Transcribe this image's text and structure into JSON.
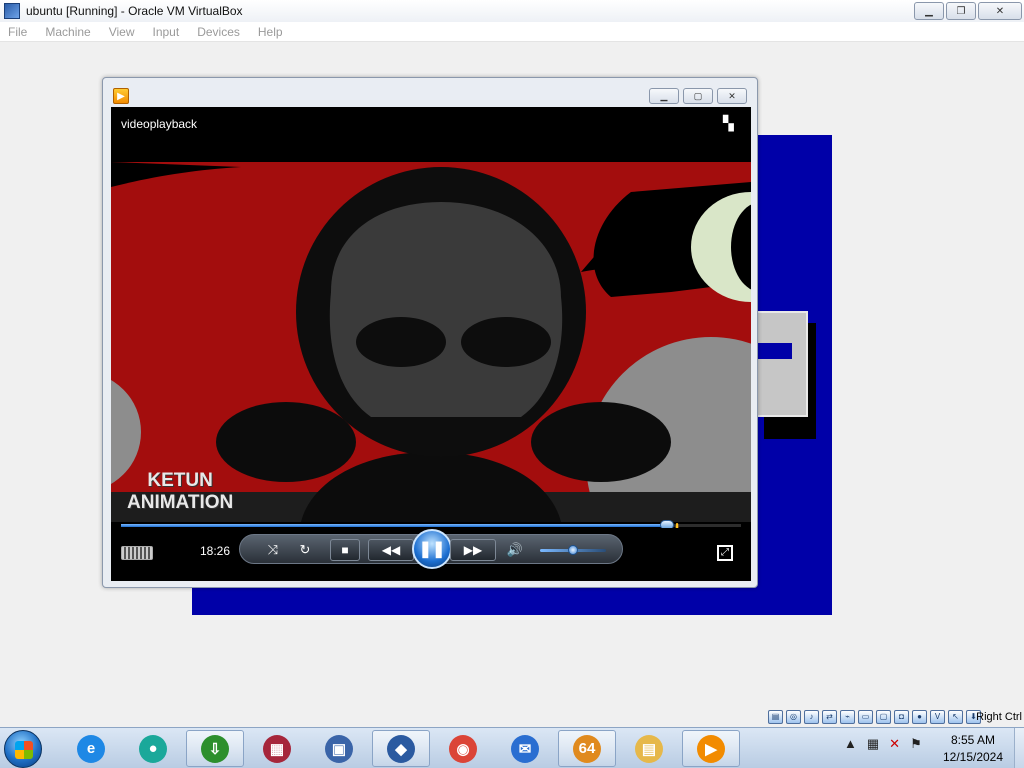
{
  "host_window": {
    "title": "ubuntu [Running] - Oracle VM VirtualBox",
    "menu": [
      "File",
      "Machine",
      "View",
      "Input",
      "Devices",
      "Help"
    ]
  },
  "media_player": {
    "video_title": "videoplayback",
    "watermark_line1": "KETUN",
    "watermark_line2": "ANIMATION",
    "time_elapsed": "18:26",
    "seek_progress": 0.88,
    "volume_level": 0.5,
    "buttons": {
      "shuffle": "⤨",
      "repeat": "↻",
      "stop": "■",
      "previous": "◀◀",
      "play_pause": "❚❚",
      "next": "▶▶",
      "mute": "🔊",
      "fullscreen": "⤢"
    }
  },
  "status_bar": {
    "host_key": "Right Ctrl"
  },
  "taskbar": {
    "apps": [
      {
        "name": "Internet Explorer",
        "glyph": "e",
        "color": "#1e88e5",
        "active": false
      },
      {
        "name": "Teams",
        "glyph": "●",
        "color": "#1aa89a",
        "active": false
      },
      {
        "name": "Internet Download Manager",
        "glyph": "⇩",
        "color": "#2d8f2d",
        "active": true
      },
      {
        "name": "WinRAR",
        "glyph": "▦",
        "color": "#a6263b",
        "active": false
      },
      {
        "name": "Remote Desktop",
        "glyph": "▣",
        "color": "#3a64a8",
        "active": false
      },
      {
        "name": "VirtualBox",
        "glyph": "◆",
        "color": "#2b5aa0",
        "active": true
      },
      {
        "name": "Chrome",
        "glyph": "◉",
        "color": "#db4437",
        "active": false
      },
      {
        "name": "Thunderbird",
        "glyph": "✉",
        "color": "#2a6ed1",
        "active": false
      },
      {
        "name": "64-bit App",
        "glyph": "64",
        "color": "#e08a1e",
        "active": true
      },
      {
        "name": "File Explorer",
        "glyph": "▤",
        "color": "#e6b84a",
        "active": false
      },
      {
        "name": "Windows Media Player",
        "glyph": "▶",
        "color": "#f28b00",
        "active": true
      }
    ],
    "clock_time": "8:55 AM",
    "clock_date": "12/15/2024"
  }
}
